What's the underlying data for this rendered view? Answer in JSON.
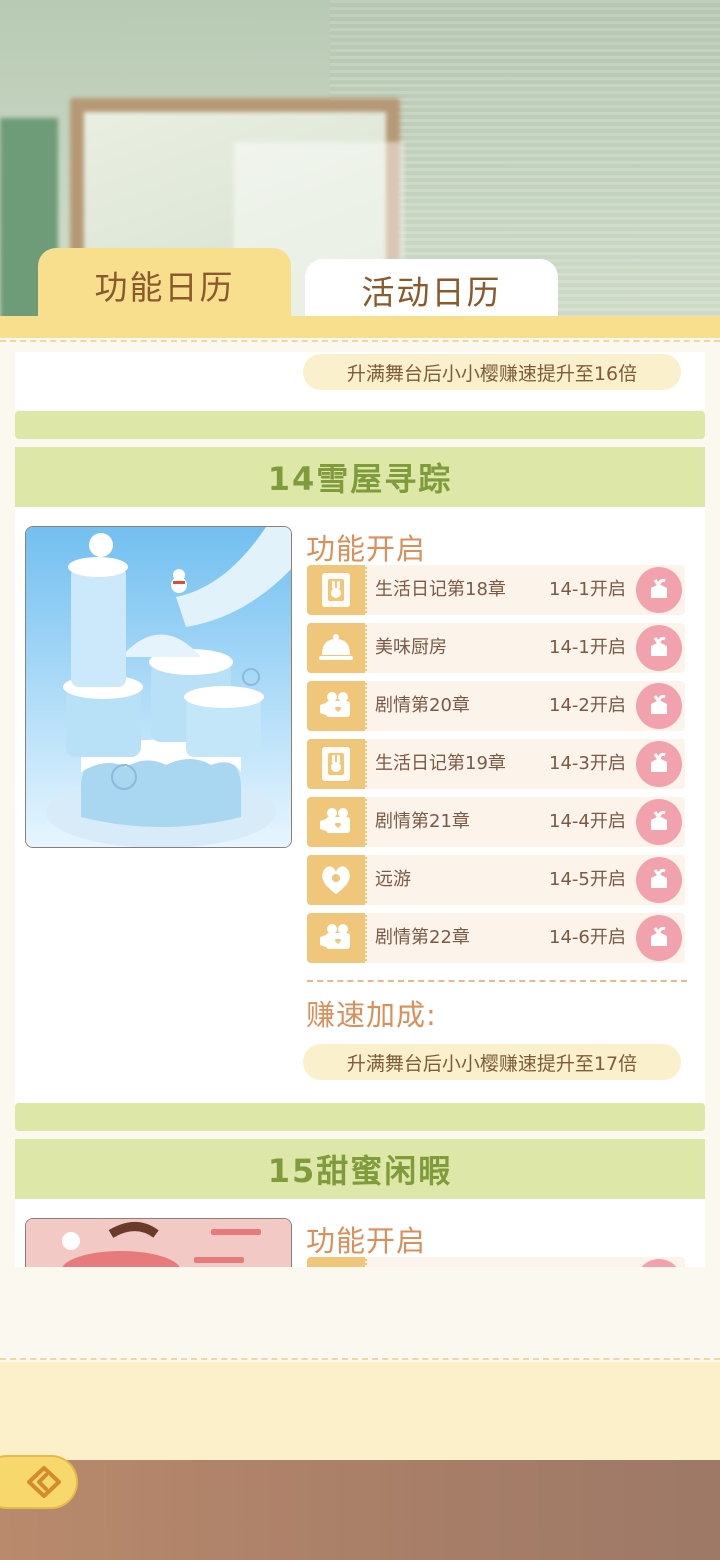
{
  "tabs": [
    {
      "label": "功能日历",
      "active": true
    },
    {
      "label": "活动日历",
      "active": false
    }
  ],
  "prev_bonus": "升满舞台后小小樱赚速提升至16倍",
  "sections": [
    {
      "title": "14雪屋寻踪",
      "unlock_label": "功能开启",
      "features": [
        {
          "icon": "diary-icon",
          "name": "生活日记第18章",
          "stage": "14-1开启"
        },
        {
          "icon": "kitchen-icon",
          "name": "美味厨房",
          "stage": "14-1开启"
        },
        {
          "icon": "camera-icon",
          "name": "剧情第20章",
          "stage": "14-2开启"
        },
        {
          "icon": "diary-icon",
          "name": "生活日记第19章",
          "stage": "14-3开启"
        },
        {
          "icon": "camera-icon",
          "name": "剧情第21章",
          "stage": "14-4开启"
        },
        {
          "icon": "travel-icon",
          "name": "远游",
          "stage": "14-5开启"
        },
        {
          "icon": "camera-icon",
          "name": "剧情第22章",
          "stage": "14-6开启"
        }
      ],
      "bonus_label": "赚速加成:",
      "bonus_text": "升满舞台后小小樱赚速提升至17倍"
    },
    {
      "title": "15甜蜜闲暇",
      "unlock_label": "功能开启"
    }
  ],
  "colors": {
    "tab_active": "#f8df8e",
    "title_bar": "#dde7a8",
    "title_text": "#7f9b3c",
    "gift": "#f1a2ac",
    "icon_bg": "#efc67a"
  }
}
